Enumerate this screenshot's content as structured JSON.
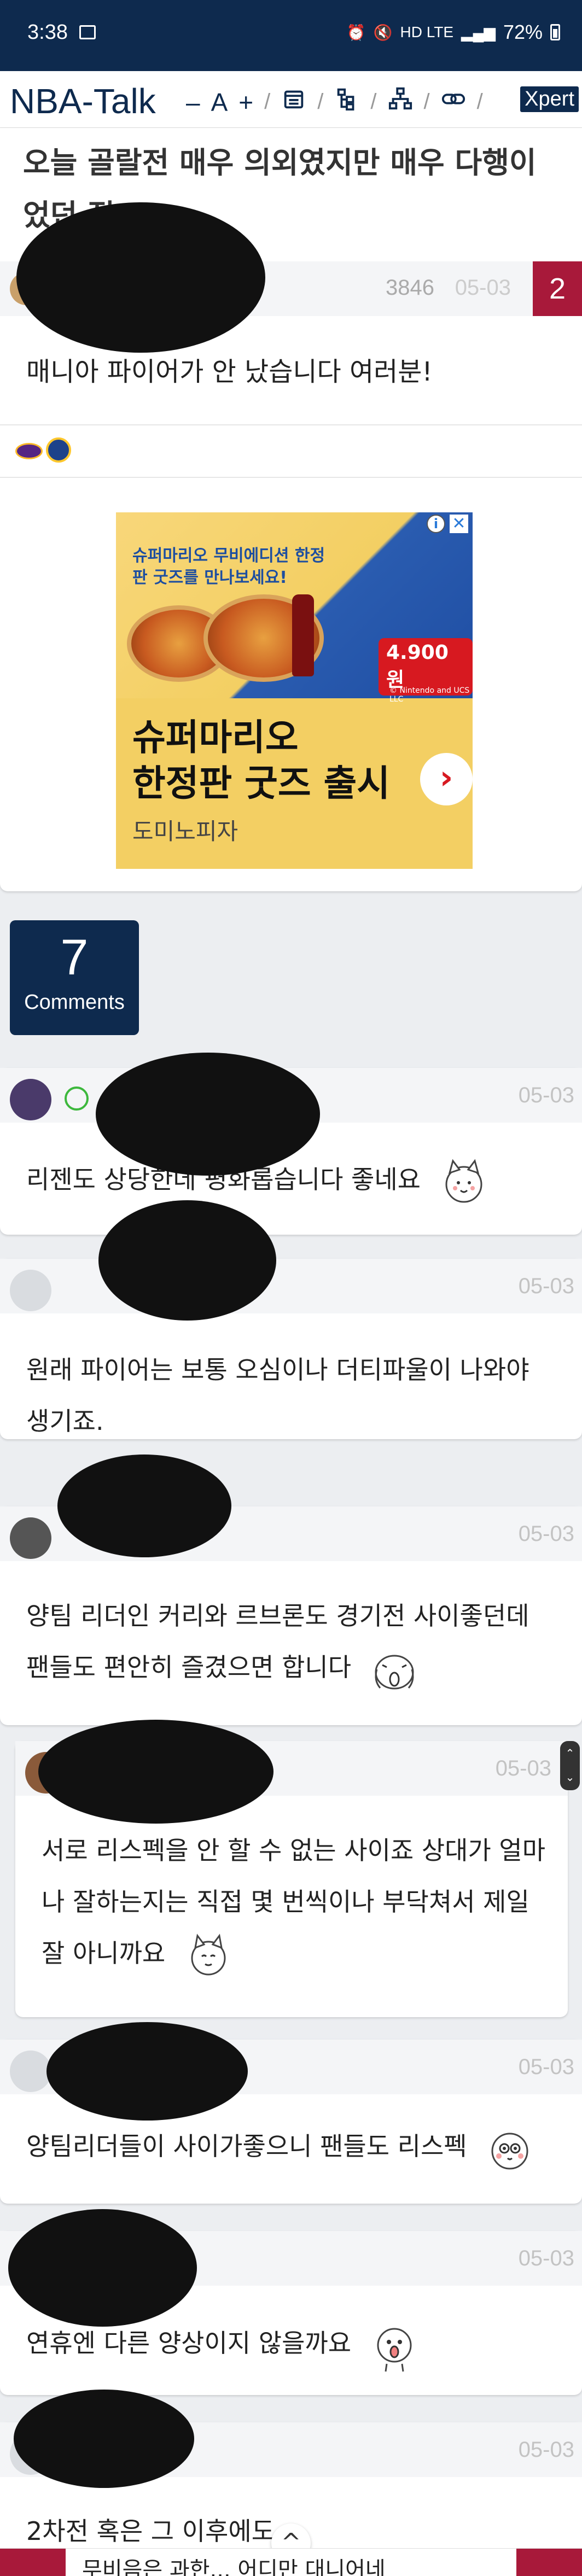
{
  "status": {
    "time": "3:38",
    "network": "HD LTE",
    "battery": "72%"
  },
  "nav": {
    "brand": "NBA-Talk",
    "minus": "–",
    "font": "A",
    "plus": "+",
    "sep": "/",
    "xpert": "Xpert"
  },
  "post": {
    "title": "오늘 골랄전 매우 의외였지만 매우 다행이었던 점",
    "views": "3846",
    "date": "05-03",
    "comment_count": "2",
    "body": "매니아 파이어가 안 났습니다 여러분!"
  },
  "ad": {
    "headline_small": "슈퍼마리오 무비에디션 한정판 굿즈를 만나보세요!",
    "price": "4.900원",
    "copyright": "© Nintendo and UCS LLC",
    "big_line1": "슈퍼마리오",
    "big_line2": "한정판 굿즈 출시",
    "brand": "도미노피자",
    "info": "i",
    "close": "✕",
    "arrow": "›"
  },
  "comments_badge": {
    "count": "7",
    "label": "Comments"
  },
  "comments": [
    {
      "date": "05-03",
      "text": "리젠도 상당한데 평화롭습니다 좋네요"
    },
    {
      "date": "05-03",
      "text_line1": "원래 파이어는 보통 오심이나 더티파울이 나와야",
      "text_line2": "생기죠."
    },
    {
      "date": "05-03",
      "text_line1": "양팀 리더인 커리와 르브론도 경기전 사이좋던데",
      "text_line2": "팬들도 편안히 즐겼으면 합니다"
    },
    {
      "date": "05-03",
      "text_line1": "서로 리스펙을 안 할 수 없는 사이죠 상대가 얼마",
      "text_line2": "나 잘하는지는 직접 몇 번씩이나 부닥쳐서 제일",
      "text_line3": "잘 아니까요"
    },
    {
      "date": "05-03",
      "text": "양팀리더들이 사이가좋으니 팬들도 리스펙"
    },
    {
      "date": "05-03",
      "text": "연휴엔 다른 양상이지 않을까요"
    },
    {
      "date": "05-03",
      "text": "2차전 혹은 그 이후에도"
    }
  ],
  "bottom": {
    "text": "무비음은 과한... 어디만 대니어네",
    "up": "^"
  }
}
